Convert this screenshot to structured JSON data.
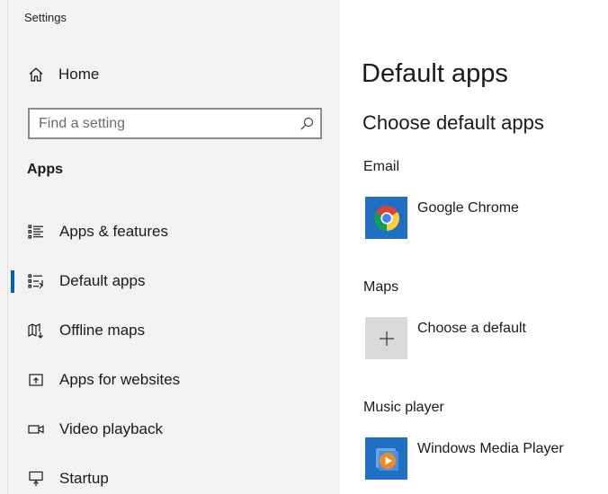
{
  "window": {
    "title": "Settings"
  },
  "sidebar": {
    "home_label": "Home",
    "search_placeholder": "Find a setting",
    "section_title": "Apps",
    "items": [
      {
        "label": "Apps & features",
        "icon": "list-icon",
        "active": false
      },
      {
        "label": "Default apps",
        "icon": "default-apps-icon",
        "active": true
      },
      {
        "label": "Offline maps",
        "icon": "map-icon",
        "active": false
      },
      {
        "label": "Apps for websites",
        "icon": "open-in-app-icon",
        "active": false
      },
      {
        "label": "Video playback",
        "icon": "video-icon",
        "active": false
      },
      {
        "label": "Startup",
        "icon": "startup-icon",
        "active": false
      }
    ]
  },
  "main": {
    "title": "Default apps",
    "subtitle": "Choose default apps",
    "categories": [
      {
        "label": "Email",
        "app": "Google Chrome",
        "icon": "chrome-icon"
      },
      {
        "label": "Maps",
        "app": "Choose a default",
        "icon": "plus-icon"
      },
      {
        "label": "Music player",
        "app": "Windows Media Player",
        "icon": "media-player-icon"
      }
    ]
  },
  "colors": {
    "accent": "#0063b1",
    "sidebar_bg": "#f2f2f2",
    "tile_blue": "#1f6fc5",
    "tile_grey": "#d9d9d9"
  }
}
